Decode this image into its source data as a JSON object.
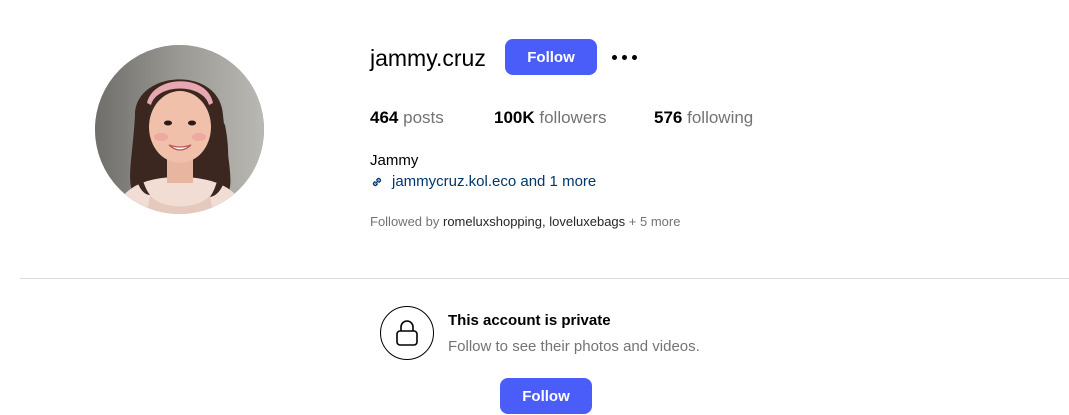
{
  "profile": {
    "username": "jammy.cruz",
    "follow_label": "Follow",
    "more_options_icon": "more-horizontal-icon",
    "avatar_icon": "profile-photo",
    "stats": {
      "posts_count": "464",
      "posts_label": "posts",
      "followers_count": "100K",
      "followers_label": "followers",
      "following_count": "576",
      "following_label": "following"
    },
    "full_name": "Jammy",
    "bio_link_icon": "link-icon",
    "bio_link_text": "jammycruz.kol.eco and 1 more",
    "followed_by": {
      "prefix": "Followed by",
      "account_1": "romeluxshopping",
      "separator": ",",
      "account_2": "loveluxebags",
      "suffix": "+ 5 more"
    }
  },
  "private_notice": {
    "lock_icon": "lock-icon",
    "title": "This account is private",
    "subtitle": "Follow to see their photos and videos.",
    "follow_label": "Follow"
  },
  "colors": {
    "accent": "#4a5df9",
    "link": "#00376b",
    "secondary_text": "#737373",
    "divider": "#dbdbdb"
  }
}
